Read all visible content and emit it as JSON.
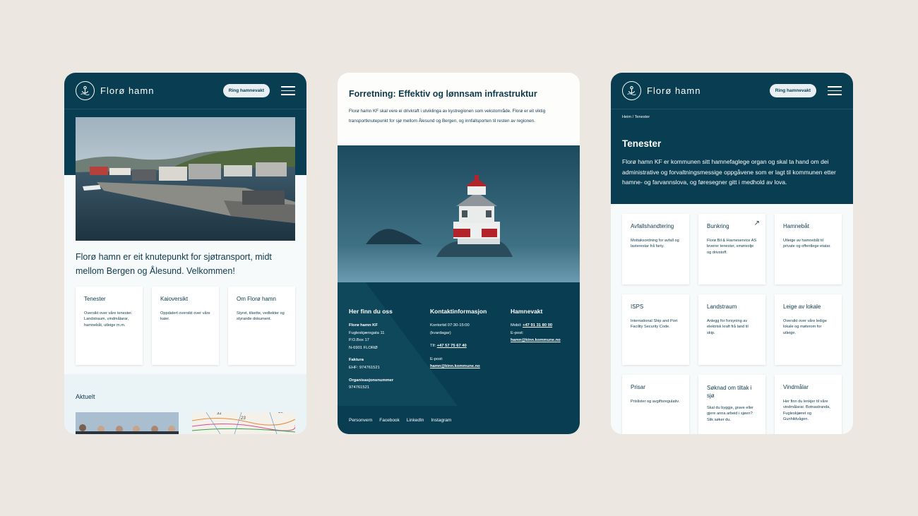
{
  "brand": "Florø hamn",
  "ring_label": "Ring hamnevakt",
  "colors": {
    "navy": "#083d52",
    "background": "#ede7e1",
    "card": "#ffffff",
    "light_section": "#eaf4f6"
  },
  "icons": {
    "logo": "harbour-logo-icon",
    "menu": "hamburger-menu-icon",
    "arrow": "arrow-up-right-icon"
  },
  "home": {
    "intro": "Florø hamn er eit knutepunkt for sjøtransport, midt mellom Bergen og Ålesund. Velkommen!",
    "cards": [
      {
        "title": "Tenester",
        "text": "Oversikt over våre tenester. Landstraum, vindmålarar, hamnebåt, utleige m.m."
      },
      {
        "title": "Kaioversikt",
        "text": "Oppdatert oversikt over våre kaier."
      },
      {
        "title": "Om Florø hamn",
        "text": "Styret, tilsette, vedtekter og styrande dokument."
      }
    ],
    "news_heading": "Aktuelt",
    "map_numbers": [
      "31",
      "23",
      "15"
    ]
  },
  "about": {
    "title": "Forretning: Effektiv og lønnsam infrastruktur",
    "text": "Florø hamn KF skal vere ei drivkraft i utviklinga av kystregionen som vekstområde. Florø er eit viktig transportknutepunkt for sjø mellom Ålesund og Bergen, og innfallsporten til resten av regionen.",
    "footer": {
      "find_us": {
        "heading": "Her finn du oss",
        "name": "Florø hamn KF",
        "street": "Fugleskjærsgata 11",
        "pobox": "P.O.Box 17",
        "postal": "N-6901 FLORØ",
        "invoice_label": "Faktura",
        "ehf": "EHF: 974761521",
        "org_label": "Organisasjonsnummer",
        "org_number": "974761521"
      },
      "contact": {
        "heading": "Kontaktinformasjon",
        "hours": "Kontortid 07:30-15:00",
        "days": "(kvardagar)",
        "phone_prefix": "Tlf: ",
        "phone": "+47 57 75 67 40",
        "email_label": "E-post:",
        "email": "hamn@kinn.kommune.no"
      },
      "harbour_watch": {
        "heading": "Hamnevakt",
        "mobile_prefix": "Mobil: ",
        "mobile": "+47 91 31 80 00",
        "email_label": "E-post:",
        "email": "hamn@kinn.kommune.no"
      },
      "links": [
        "Personvern",
        "Facebook",
        "LinkedIn",
        "Instagram"
      ]
    }
  },
  "services": {
    "breadcrumb": "Heim / Tenester",
    "title": "Tenester",
    "intro": "Florø hamn KF er kommunen sitt hamnefaglege organ og skal ta hand om dei administrative og forvaltningsmessige oppgåvene som er lagt til kommunen etter hamne- og farvannslova, og føresegner gitt i medhold av lova.",
    "items": [
      {
        "title": "Avfallshandtering",
        "text": "Mottaksordning for avfall og lasterestar frå farty."
      },
      {
        "title": "Bunkring",
        "text": "Florø Bil & Havneservice AS leverer tenester, smøreolje og drivstoff."
      },
      {
        "title": "Hamnebåt",
        "text": "Utleige av hamnebåt til private og offentlege etatar."
      },
      {
        "title": "ISPS",
        "text": "International Ship and Port Facility Security Code."
      },
      {
        "title": "Landstraum",
        "text": "Anlegg for forsyning av elektrisk kraft frå land til skip."
      },
      {
        "title": "Leige av lokale",
        "text": "Oversikt over våre ledige lokale og møterom for utleige."
      },
      {
        "title": "Prisar",
        "text": "Prislister og avgiftsregulativ."
      },
      {
        "title": "Søknad om tiltak i sjø",
        "text": "Skal du byggje, grave eller gjere anna arbeid i sjøen? Slik søker du."
      },
      {
        "title": "Vindmålar",
        "text": "Her finn du lenkjer til våre vindmålarar. Botnastranda, Fugleskjæret og Gunhildvågen."
      }
    ]
  }
}
